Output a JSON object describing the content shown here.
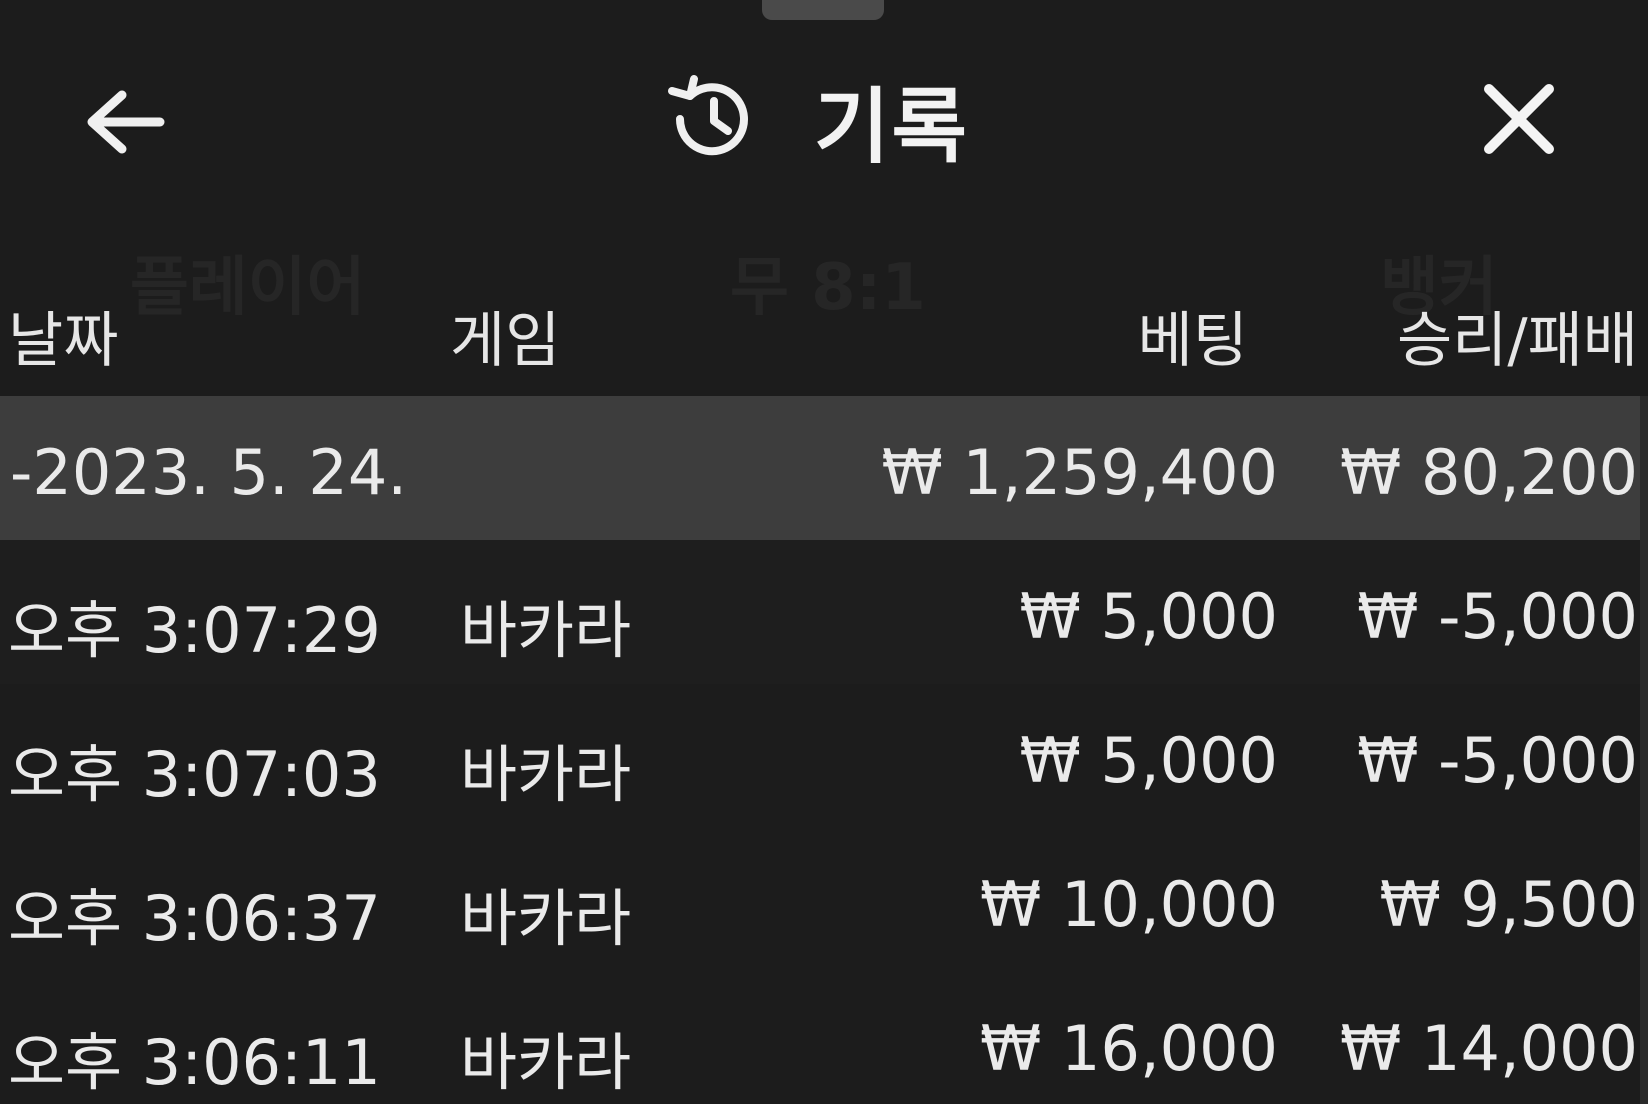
{
  "header": {
    "title": "기록",
    "back_icon": "arrow-left-icon",
    "history_icon": "history-icon",
    "close_icon": "close-icon"
  },
  "columns": {
    "date": "날짜",
    "game": "게임",
    "bet": "베팅",
    "result": "승리/패배"
  },
  "summary": {
    "date": "-2023. 5. 24.",
    "bet": "₩ 1,259,400",
    "result": "₩ 80,200"
  },
  "rows": [
    {
      "time": "오후 3:07:29",
      "game": "바카라",
      "bet": "₩ 5,000",
      "result": "₩ -5,000"
    },
    {
      "time": "오후 3:07:03",
      "game": "바카라",
      "bet": "₩ 5,000",
      "result": "₩ -5,000"
    },
    {
      "time": "오후 3:06:37",
      "game": "바카라",
      "bet": "₩ 10,000",
      "result": "₩ 9,500"
    },
    {
      "time": "오후 3:06:11",
      "game": "바카라",
      "bet": "₩ 16,000",
      "result": "₩ 14,000"
    }
  ],
  "colors": {
    "background": "#1c1c1c",
    "summary_row": "#3d3d3d",
    "text": "#eaeaea"
  }
}
